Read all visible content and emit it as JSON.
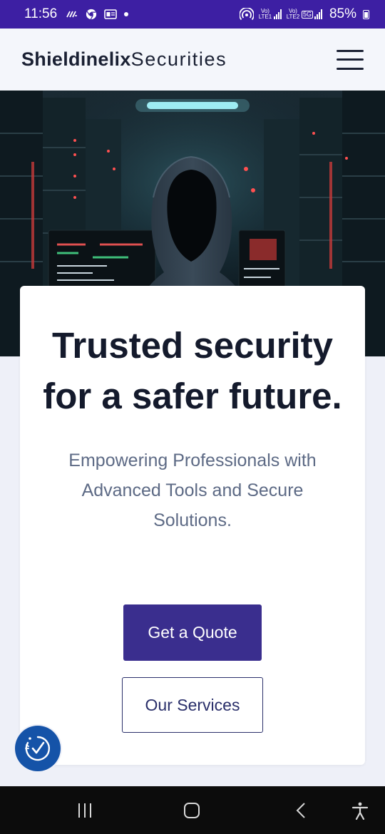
{
  "status_bar": {
    "time": "11:56",
    "left_icons": [
      "wifi-calling-icon",
      "chrome-icon",
      "news-icon",
      "dot-icon"
    ],
    "right_icons": [
      "hotspot-icon",
      "volte1-signal-icon",
      "volte2-5g-signal-icon"
    ],
    "sim1_label": "Vo) LTE1",
    "sim2_label": "Vo) LTE2",
    "network_label": "5G",
    "battery": "85%"
  },
  "header": {
    "brand_bold": "Shieldinelix",
    "brand_light": "Securities",
    "menu_icon": "hamburger-icon"
  },
  "hero": {
    "image": "hooded-hacker-server-room-photo"
  },
  "card": {
    "headline": "Trusted security for a safer future.",
    "subheadline": "Empowering Professionals with Advanced Tools and Secure Solutions.",
    "primary_button": "Get a Quote",
    "secondary_button": "Our Services"
  },
  "accessibility_widget": {
    "icon": "accessibility-check-icon"
  },
  "system_nav": {
    "items": [
      "recent-apps-icon",
      "home-icon",
      "back-icon",
      "accessibility-icon"
    ]
  },
  "colors": {
    "status_bar": "#3d1fa3",
    "primary_button": "#3a2e8e",
    "headline": "#141a2c",
    "subtext": "#5d6a85",
    "a11y_button": "#1553a8"
  }
}
